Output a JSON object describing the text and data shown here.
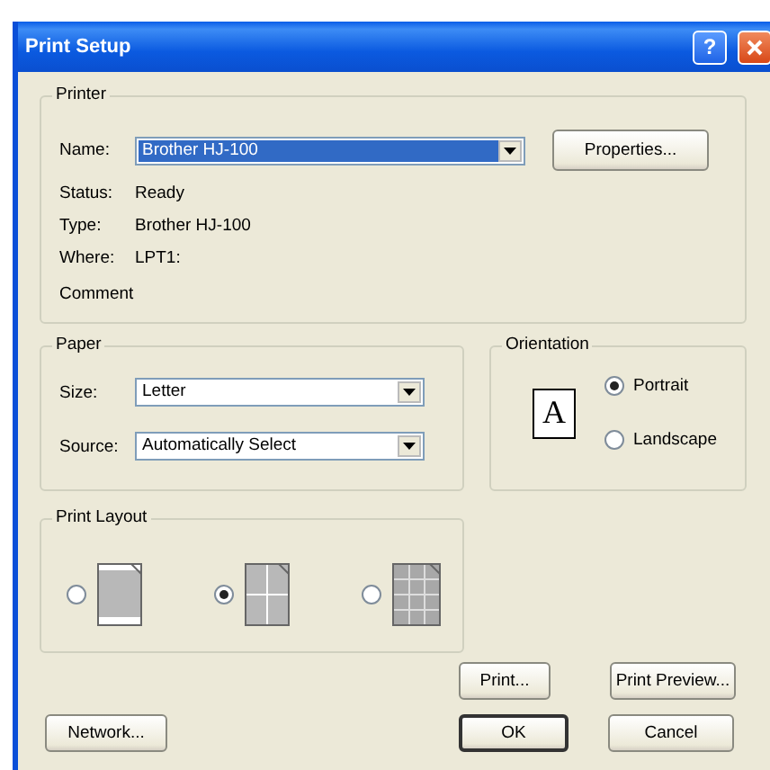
{
  "window": {
    "title": "Print Setup",
    "help": "?"
  },
  "printer": {
    "title": "Printer",
    "name": {
      "label": "Name:",
      "value": "Brother HJ-100",
      "focused": true
    },
    "properties_button": "Properties...",
    "info": [
      {
        "label": "Status:",
        "value": "Ready"
      },
      {
        "label": "Type:",
        "value": "Brother HJ-100"
      },
      {
        "label": "Where:",
        "value": "LPT1:"
      },
      {
        "label": "Comment"
      }
    ]
  },
  "paper": {
    "title": "Paper",
    "fields": [
      {
        "label": "Size:",
        "value": "Letter"
      },
      {
        "label": "Source:",
        "value": "Automatically Select"
      }
    ]
  },
  "orientation": {
    "title": "Orientation",
    "preview": "A",
    "options": [
      {
        "label": "Portrait",
        "selected": true
      },
      {
        "label": "Landscape",
        "selected": false
      }
    ]
  },
  "print_layout": {
    "title": "Print Layout",
    "options": [
      {
        "kind": "single",
        "selected": false
      },
      {
        "kind": "quad",
        "selected": true
      },
      {
        "kind": "grid",
        "selected": false
      }
    ]
  },
  "buttons": [
    {
      "label": "Print...",
      "default": false
    },
    {
      "label": "Print Preview...",
      "default": false
    },
    {
      "label": "Network...",
      "default": false
    },
    {
      "label": "OK",
      "default": true
    },
    {
      "label": "Cancel",
      "default": false
    }
  ]
}
